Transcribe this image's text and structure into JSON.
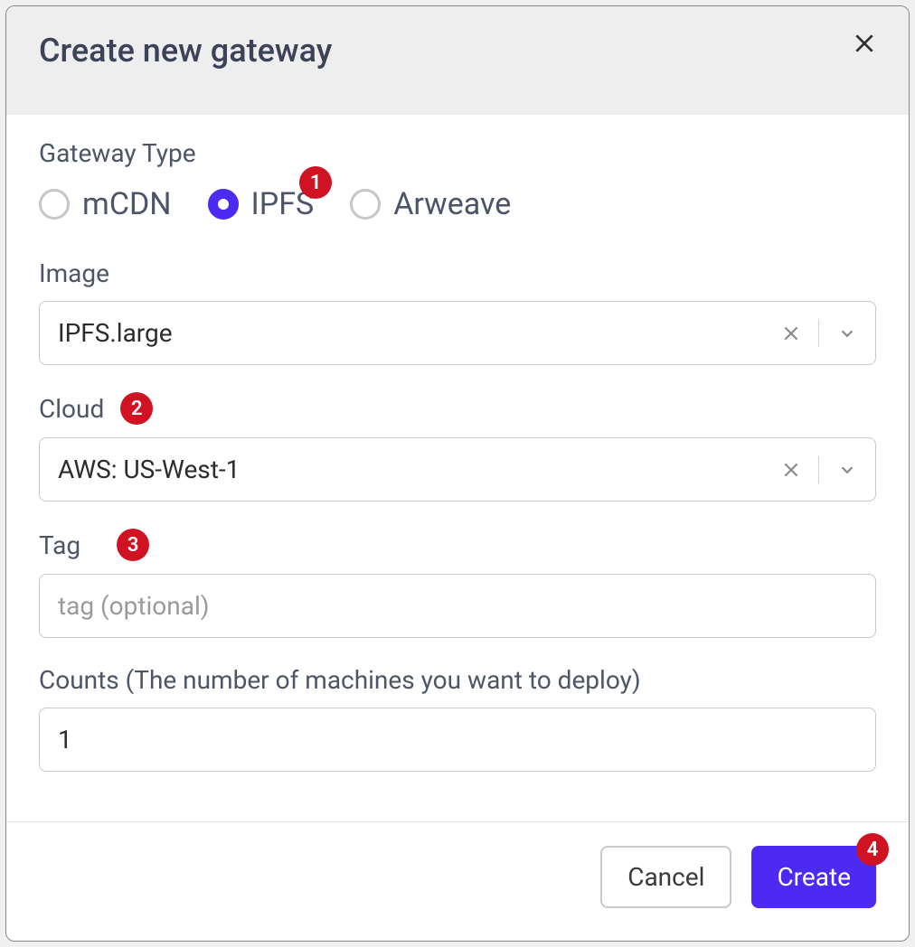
{
  "modal": {
    "title": "Create new gateway",
    "gateway_type_label": "Gateway Type",
    "radio_options": {
      "mcdn": "mCDN",
      "ipfs": "IPFS",
      "arweave": "Arweave"
    },
    "image": {
      "label": "Image",
      "value": "IPFS.large"
    },
    "cloud": {
      "label": "Cloud",
      "value": "AWS: US-West-1"
    },
    "tag": {
      "label": "Tag",
      "placeholder": "tag (optional)",
      "value": ""
    },
    "counts": {
      "label": "Counts (The number of machines you want to deploy)",
      "value": "1"
    },
    "footer": {
      "cancel": "Cancel",
      "create": "Create"
    }
  },
  "badges": {
    "b1": "1",
    "b2": "2",
    "b3": "3",
    "b4": "4"
  }
}
